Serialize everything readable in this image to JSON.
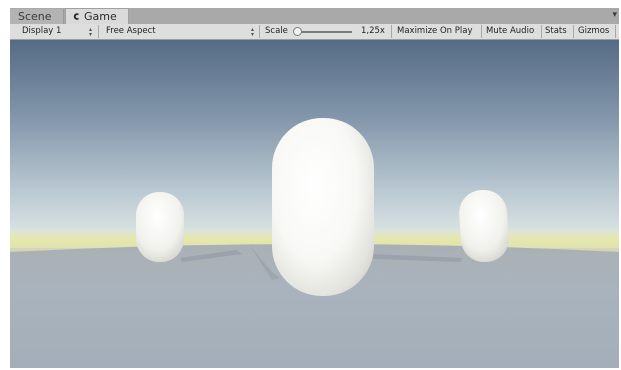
{
  "tabs": {
    "scene_label": "Scene",
    "game_label": "Game"
  },
  "toolbar": {
    "display_select": "Display 1",
    "aspect_select": "Free Aspect",
    "scale_label": "Scale",
    "scale_value": "1,25x",
    "scale_level": 0.05,
    "maximize_label": "Maximize On Play",
    "mute_label": "Mute Audio",
    "stats_label": "Stats",
    "gizmos_label": "Gizmos"
  },
  "colors": {
    "sky_top": "#566b85",
    "sky_horizon": "#d8e2e3",
    "horizon_glow": "#e6e8a6",
    "ground": "#a9b3bd"
  }
}
